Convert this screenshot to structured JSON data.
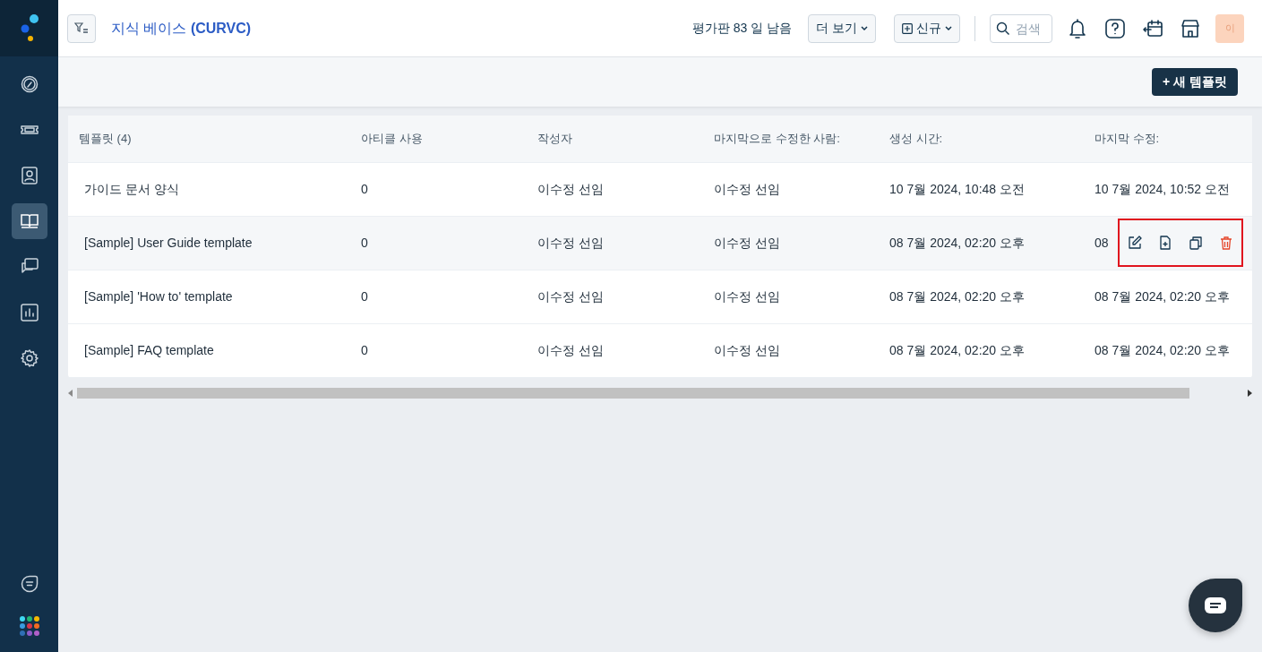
{
  "sidebar": {
    "items": [
      {
        "selected": false
      },
      {
        "selected": false
      },
      {
        "selected": false
      },
      {
        "selected": true
      },
      {
        "selected": false
      },
      {
        "selected": false
      },
      {
        "selected": false
      }
    ]
  },
  "header": {
    "title": "지식 베이스 **(CURVC)**",
    "trial": "평가판 83 일 남음",
    "more_button": "더 보기",
    "new_button": "신규",
    "search": {
      "placeholder": "검색"
    },
    "avatar": "이"
  },
  "toolbar": {
    "new_template_button": "+ 새 템플릿"
  },
  "table": {
    "columns": [
      "템플릿 (4)",
      "아티클 사용",
      "작성자",
      "마지막으로 수정한 사람:",
      "생성 시간:",
      "마지막 수정:"
    ],
    "rows": [
      {
        "hovered": false,
        "cells": [
          "가이드 문서 양식",
          "0",
          "이수정 선임",
          "이수정 선임",
          "10 7월 2024, 10:48 오전",
          "10 7월 2024, 10:52 오전"
        ]
      },
      {
        "hovered": true,
        "cells": [
          "[Sample] User Guide template",
          "0",
          "이수정 선임",
          "이수정 선임",
          "08 7월 2024, 02:20 오후",
          "08"
        ]
      },
      {
        "hovered": false,
        "cells": [
          "[Sample] 'How to' template",
          "0",
          "이수정 선임",
          "이수정 선임",
          "08 7월 2024, 02:20 오후",
          "08 7월 2024, 02:20 오후"
        ]
      },
      {
        "hovered": false,
        "cells": [
          "[Sample] FAQ template",
          "0",
          "이수정 선임",
          "이수정 선임",
          "08 7월 2024, 02:20 오후",
          "08 7월 2024, 02:20 오후"
        ]
      }
    ]
  }
}
